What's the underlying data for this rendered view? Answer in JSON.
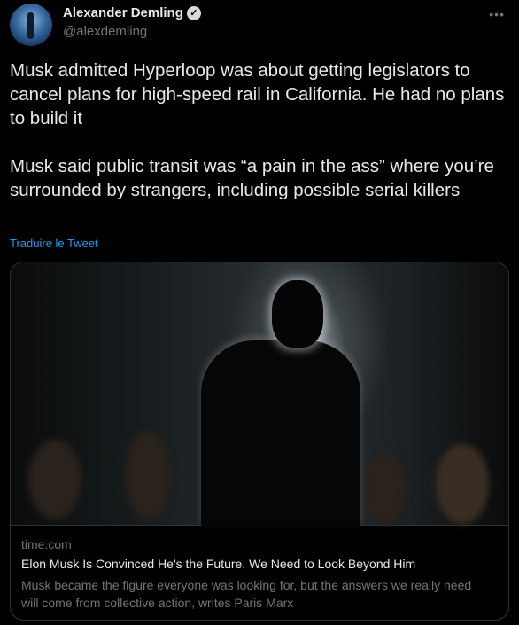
{
  "author": {
    "name": "Alexander Demling",
    "handle": "@alexdemling",
    "verified": true,
    "verified_icon": "check-icon"
  },
  "more_icon": "more-horizontal-icon",
  "tweet": {
    "paragraphs": [
      "Musk admitted Hyperloop was about getting legislators to cancel plans for high-speed rail in California. He had no plans to build it",
      "Musk said public transit was “a pain in the ass” where you’re surrounded by strangers, including possible serial killers"
    ],
    "translate_label": "Traduire le Tweet"
  },
  "card": {
    "domain": "time.com",
    "headline": "Elon Musk Is Convinced He's the Future. We Need to Look Beyond Him",
    "description": "Musk became the figure everyone was looking for, but the answers we really need will come from collective action, writes Paris Marx"
  },
  "colors": {
    "background": "#000000",
    "text": "#e7e9ea",
    "muted": "#71767b",
    "link": "#1d9bf0",
    "border": "#2f3336"
  }
}
